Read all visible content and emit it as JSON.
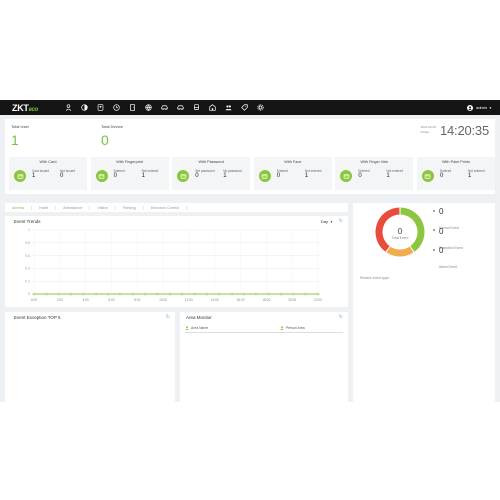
{
  "header": {
    "logo_main": "ZKT",
    "logo_suffix": "eco",
    "nav_icons": [
      "person-icon",
      "contrast-icon",
      "id-card-icon",
      "clock-icon",
      "door-icon",
      "globe-icon",
      "car-icon",
      "car-icon",
      "bus-icon",
      "building-icon",
      "user-group-icon",
      "tag-icon",
      "gear-icon"
    ],
    "user": "admin",
    "accent": "#7ac143"
  },
  "stats": {
    "total_user_label": "Total User",
    "total_user_value": "1",
    "total_device_label": "Total Device",
    "total_device_value": "0",
    "date_line1": "2021-02-05",
    "date_line2": "Friday",
    "time": "14:20:35"
  },
  "cards": [
    {
      "title": "With Card",
      "icon": "card-icon",
      "c1_label": "Card issued",
      "c1_value": "1",
      "c2_label": "Not issued",
      "c2_value": "0"
    },
    {
      "title": "With Fingerprint",
      "icon": "fingerprint-icon",
      "c1_label": "Entered",
      "c1_value": "0",
      "c2_label": "Not entered",
      "c2_value": "1"
    },
    {
      "title": "With Password",
      "icon": "password-icon",
      "c1_label": "Set password",
      "c1_value": "0",
      "c2_label": "No password",
      "c2_value": "1"
    },
    {
      "title": "With Face",
      "icon": "face-icon",
      "c1_label": "Entered",
      "c1_value": "0",
      "c2_label": "Not entered",
      "c2_value": "1"
    },
    {
      "title": "With Finger Vein",
      "icon": "finger-vein-icon",
      "c1_label": "Entered",
      "c1_value": "0",
      "c2_label": "Not entered",
      "c2_value": "1"
    },
    {
      "title": "With Palm Prints",
      "icon": "palm-icon",
      "c1_label": "Entered",
      "c1_value": "0",
      "c2_label": "Not entered",
      "c2_value": "1"
    }
  ],
  "tabs": [
    "Access",
    "Hotel",
    "Attendance",
    "Visitor",
    "Parking",
    "Entrance Control"
  ],
  "trends": {
    "title": "Event Trends",
    "period": "Day",
    "chart_data": {
      "type": "line",
      "x": [
        "0:00",
        "2:00",
        "4:00",
        "6:00",
        "8:00",
        "10:00",
        "12:00",
        "14:00",
        "16:00",
        "18:00",
        "20:00",
        "22:00"
      ],
      "series": [
        {
          "values": [
            0,
            0,
            0,
            0,
            0,
            0,
            0,
            0,
            0,
            0,
            0,
            0,
            0,
            0,
            0,
            0,
            0,
            0,
            0,
            0,
            0,
            0,
            0,
            0
          ]
        }
      ],
      "yticks": [
        "1",
        "0.8",
        "0.6",
        "0.4",
        "0.2",
        "0"
      ],
      "ylim": [
        0,
        1
      ],
      "grid": true,
      "color": "#8cc63f"
    }
  },
  "exception": {
    "title": "Event Exception TOP 5"
  },
  "monitor": {
    "title": "Area Monitor",
    "col_area": "Area Name",
    "col_person": "Person Area"
  },
  "events": {
    "total_value": "0",
    "total_label": "Total Event",
    "donut_colors": [
      "#8cc63f",
      "#f0ad4e",
      "#e74c3c"
    ],
    "legend": [
      {
        "value": "0",
        "label": "Normal Event"
      },
      {
        "value": "0",
        "label": "Exception Event"
      },
      {
        "value": "0",
        "label": "Alarm Event"
      }
    ],
    "recent_label": "Recent event type"
  }
}
